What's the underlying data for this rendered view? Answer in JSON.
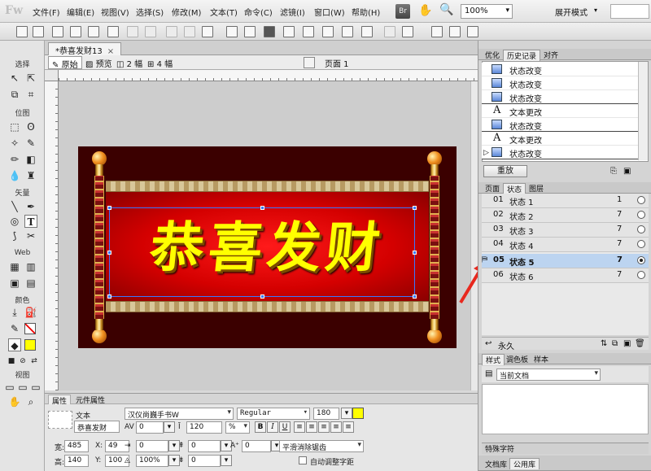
{
  "app": {
    "logo": "Fw"
  },
  "menu": {
    "items": [
      "文件(F)",
      "编辑(E)",
      "视图(V)",
      "选择(S)",
      "修改(M)",
      "文本(T)",
      "命令(C)",
      "滤镜(I)",
      "窗口(W)",
      "帮助(H)"
    ],
    "br": "Br",
    "zoom": "100%",
    "mode": "展开模式"
  },
  "tools": {
    "select": "选择",
    "bitmap": "位图",
    "vector": "矢量",
    "web": "Web",
    "colors": "颜色",
    "view": "视图"
  },
  "document": {
    "tab": "*恭喜发财13",
    "close": "×",
    "views": [
      "原始",
      "预览",
      "2 幅",
      "4 幅"
    ],
    "page": "页面 1",
    "canvas_text": "恭喜发财"
  },
  "properties": {
    "tabs": [
      "属性",
      "元件属性"
    ],
    "type": "文本",
    "name": "恭喜发财",
    "font": "汉仪尚巍手书W",
    "style": "Regular",
    "size": "180",
    "text_color": "#ffff00",
    "kerning": "0",
    "leading": "120",
    "leading_unit": "%",
    "bold": "B",
    "italic": "I",
    "underline": "U",
    "indent": "0",
    "space_before": "0",
    "space_after": "0",
    "baseline": "0",
    "antialias": "平滑消除锯齿",
    "auto_kern": "自动调整字距",
    "width_label": "宽:",
    "width": "485",
    "height_label": "高:",
    "height": "140",
    "x_label": "X:",
    "x": "49",
    "y_label": "Y:",
    "y": "100",
    "opacity": "100%"
  },
  "panels": {
    "top_tabs": [
      "优化",
      "历史记录",
      "对齐"
    ],
    "history": [
      {
        "icon": "state",
        "label": "状态改变"
      },
      {
        "icon": "state",
        "label": "状态改变"
      },
      {
        "icon": "state",
        "label": "状态改变"
      },
      {
        "icon": "text",
        "label": "文本更改"
      },
      {
        "icon": "state",
        "label": "状态改变"
      },
      {
        "icon": "text",
        "label": "文本更改"
      },
      {
        "icon": "state",
        "label": "状态改变"
      }
    ],
    "text_glyph": "A",
    "replay": "重放",
    "mid_tabs": [
      "页面",
      "状态",
      "图层"
    ],
    "states": [
      {
        "num": "01",
        "name": "状态 1",
        "delay": "1"
      },
      {
        "num": "02",
        "name": "状态 2",
        "delay": "7"
      },
      {
        "num": "03",
        "name": "状态 3",
        "delay": "7"
      },
      {
        "num": "04",
        "name": "状态 4",
        "delay": "7"
      },
      {
        "num": "05",
        "name": "状态 5",
        "delay": "7"
      },
      {
        "num": "06",
        "name": "状态 6",
        "delay": "7"
      }
    ],
    "selected_state": 4,
    "forever": "永久",
    "lower_tabs": [
      "样式",
      "调色板",
      "样本"
    ],
    "styles_select": "当前文档",
    "bottom_label": "特殊字符",
    "bottom_tabs": [
      "文档库",
      "公用库"
    ]
  },
  "colors": {
    "accent": "#3a78ff",
    "arrow": "#e8281e",
    "canvas_bg": "#3b0000"
  }
}
